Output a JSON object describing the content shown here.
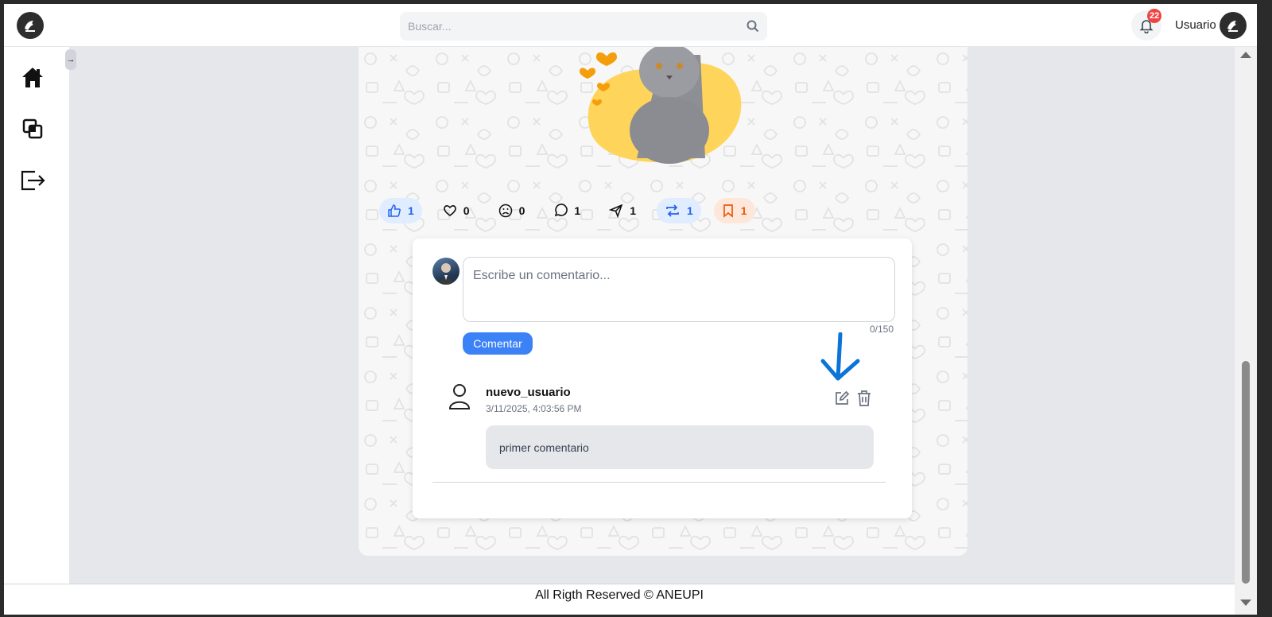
{
  "header": {
    "search_placeholder": "Buscar...",
    "notification_count": "22",
    "username": "Usuario"
  },
  "sidebar": {
    "items": [
      {
        "icon": "home-icon"
      },
      {
        "icon": "layers-icon"
      },
      {
        "icon": "logout-icon"
      }
    ],
    "collapse_label": "→"
  },
  "post": {
    "reactions": [
      {
        "icon": "thumbs-up-icon",
        "count": "1"
      },
      {
        "icon": "heart-icon",
        "count": "0"
      },
      {
        "icon": "sad-face-icon",
        "count": "0"
      },
      {
        "icon": "comment-icon",
        "count": "1"
      },
      {
        "icon": "send-icon",
        "count": "1"
      },
      {
        "icon": "repost-icon",
        "count": "1"
      },
      {
        "icon": "bookmark-icon",
        "count": "1"
      }
    ]
  },
  "comments": {
    "input_placeholder": "Escribe un comentario...",
    "counter": "0/150",
    "submit_label": "Comentar",
    "items": [
      {
        "author": "nuevo_usuario",
        "date": "3/11/2025, 4:03:56 PM",
        "text": "primer comentario"
      }
    ]
  },
  "footer": {
    "text": "All Rigth Reserved © ANEUPI"
  },
  "colors": {
    "accent": "#3b82f6",
    "badge": "#ef4444",
    "annotation_arrow": "#0b74d6"
  }
}
